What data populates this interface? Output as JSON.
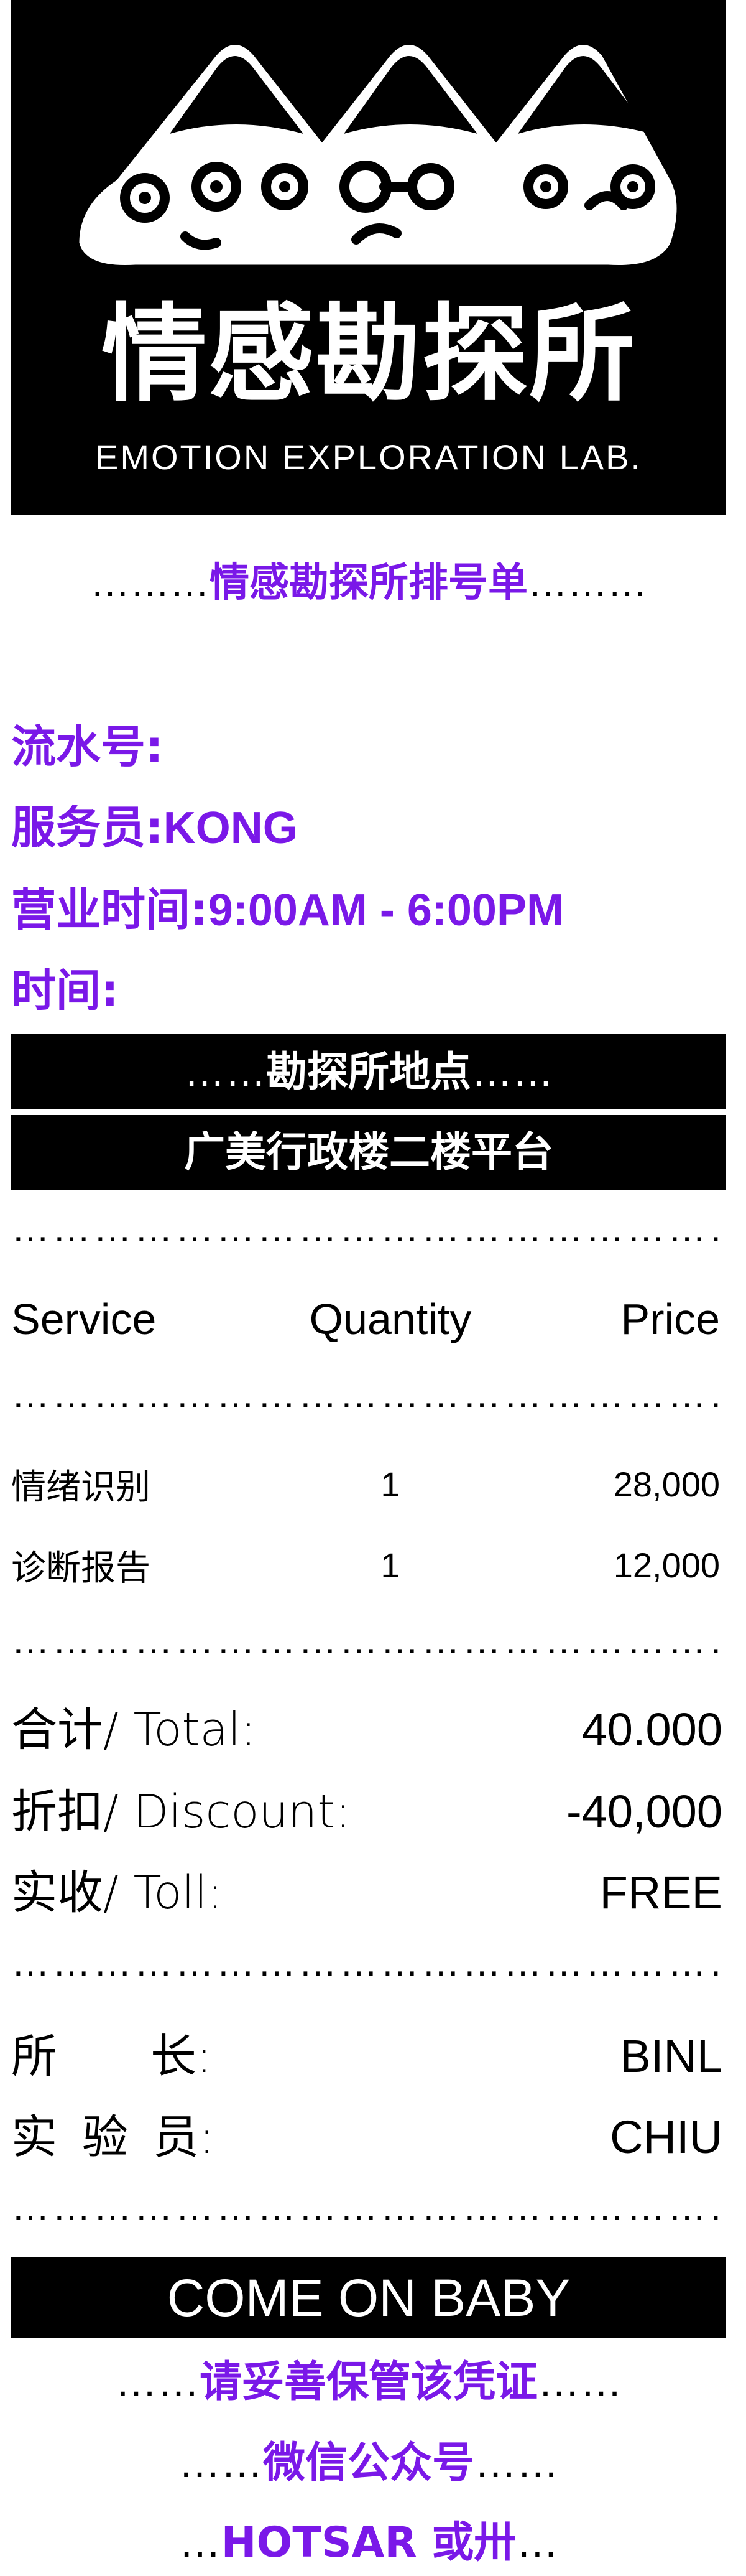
{
  "logo": {
    "chinese": "情感勘探所",
    "english": "EMOTION EXPLORATION LAB."
  },
  "dots": {
    "full": "……………………………………………………………"
  },
  "receipt_title": {
    "prefix": "………",
    "text": "情感勘探所排号单",
    "suffix": "………"
  },
  "info": {
    "serial_label": "流水号:",
    "serial_value": "",
    "server_label": "服务员:",
    "server_value": "KONG",
    "hours_label": "营业时间:",
    "hours_value": "9:00AM - 6:00PM",
    "time_label": "时间:",
    "time_value": ""
  },
  "location": {
    "header_prefix": "……",
    "header": "勘探所地点",
    "header_suffix": "……",
    "address": "广美行政楼二楼平台"
  },
  "table": {
    "headers": [
      "Service",
      "Quantity",
      "Price"
    ],
    "rows": [
      {
        "service": "情绪识别",
        "quantity": "1",
        "price": "28,000"
      },
      {
        "service": "诊断报告",
        "quantity": "1",
        "price": "12,000"
      }
    ]
  },
  "totals": {
    "total_label": "合计/ Total:",
    "total_value": "40.000",
    "discount_label": "折扣/ Discount:",
    "discount_value": "-40,000",
    "toll_label": "实收/ Toll:",
    "toll_value": "FREE"
  },
  "staff": {
    "director_label_chars": [
      "所",
      "长:"
    ],
    "director_value": "BINL",
    "lab_label_chars": [
      "实",
      "验",
      "员:"
    ],
    "lab_value": "CHIU"
  },
  "footer": {
    "banner": "COME ON BABY",
    "line1_prefix": "……",
    "line1": "请妥善保管该凭证",
    "line1_suffix": "……",
    "line2_prefix": "……",
    "line2": "微信公众号",
    "line2_suffix": "……",
    "line3_prefix": "…",
    "line3": "HOTSAR 或卅",
    "line3_suffix": "…"
  },
  "colors": {
    "accent": "#7a18e8",
    "bar": "#000000",
    "bar_text": "#ffffff"
  }
}
